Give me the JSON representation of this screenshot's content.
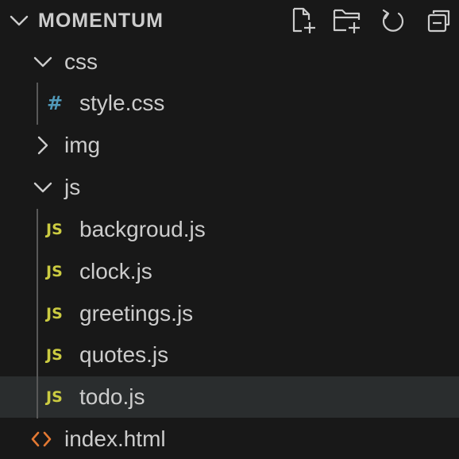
{
  "explorer": {
    "project_title": "MOMENTUM",
    "actions": [
      {
        "name": "new-file"
      },
      {
        "name": "new-folder"
      },
      {
        "name": "refresh-explorer"
      },
      {
        "name": "collapse-folders"
      }
    ]
  },
  "tree": {
    "css_folder": {
      "label": "css",
      "expanded": true
    },
    "style_css": {
      "label": "style.css",
      "icon_glyph": "#"
    },
    "img_folder": {
      "label": "img",
      "expanded": false
    },
    "js_folder": {
      "label": "js",
      "expanded": true
    },
    "js_files": [
      {
        "label": "backgroud.js",
        "icon_glyph": "JS"
      },
      {
        "label": "clock.js",
        "icon_glyph": "JS"
      },
      {
        "label": "greetings.js",
        "icon_glyph": "JS"
      },
      {
        "label": "quotes.js",
        "icon_glyph": "JS"
      },
      {
        "label": "todo.js",
        "icon_glyph": "JS",
        "selected": true
      }
    ],
    "index_html": {
      "label": "index.html"
    }
  },
  "colors": {
    "background": "#181818",
    "selected_row": "#2a2d2e",
    "text": "#cccccc",
    "js_icon": "#cbcb41",
    "css_icon": "#519aba",
    "html_icon": "#e37933",
    "indent_guide": "#585858"
  }
}
